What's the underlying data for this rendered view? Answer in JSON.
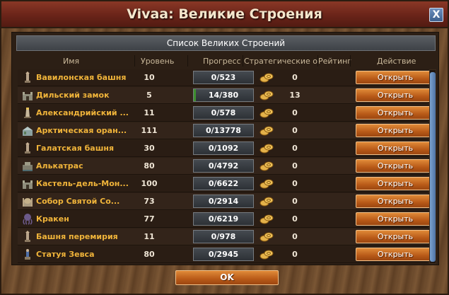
{
  "window": {
    "title": "Vivaa: Великие Строения",
    "close_label": "X",
    "subheader": "Список Великих Строений",
    "ok_label": "OK"
  },
  "columns": {
    "name": "Имя",
    "level": "Уровень",
    "progress": "Прогресс",
    "points": "Стратегические очки",
    "rating": "Рейтинг",
    "action": "Действие"
  },
  "colors": {
    "name_text": "#f0b43a",
    "button": "#c86a22",
    "progress_fill": "#3e8f2e",
    "title_bar": "#6a2419"
  },
  "buildings": [
    {
      "name": "Вавилонская башня",
      "level": "10",
      "progress": "0/523",
      "points": "0",
      "action": "Открыть",
      "icon": "tower-icon",
      "fill": 0
    },
    {
      "name": "Дильский замок",
      "level": "5",
      "progress": "14/380",
      "points": "13",
      "action": "Открыть",
      "icon": "castle-icon",
      "fill": 0.037
    },
    {
      "name": "Александрийский ...",
      "level": "11",
      "progress": "0/578",
      "points": "0",
      "action": "Открыть",
      "icon": "lighthouse-icon",
      "fill": 0
    },
    {
      "name": "Арктическая оран...",
      "level": "111",
      "progress": "0/13778",
      "points": "0",
      "action": "Открыть",
      "icon": "greenhouse-icon",
      "fill": 0
    },
    {
      "name": "Галатская башня",
      "level": "30",
      "progress": "0/1092",
      "points": "0",
      "action": "Открыть",
      "icon": "tower-icon",
      "fill": 0
    },
    {
      "name": "Алькатрас",
      "level": "80",
      "progress": "0/4792",
      "points": "0",
      "action": "Открыть",
      "icon": "prison-icon",
      "fill": 0
    },
    {
      "name": "Кастель-дель-Мон...",
      "level": "100",
      "progress": "0/6622",
      "points": "0",
      "action": "Открыть",
      "icon": "castle-icon",
      "fill": 0
    },
    {
      "name": "Собор Святой Со...",
      "level": "73",
      "progress": "0/2914",
      "points": "0",
      "action": "Открыть",
      "icon": "cathedral-icon",
      "fill": 0
    },
    {
      "name": "Кракен",
      "level": "77",
      "progress": "0/6219",
      "points": "0",
      "action": "Открыть",
      "icon": "kraken-icon",
      "fill": 0
    },
    {
      "name": "Башня перемирия",
      "level": "11",
      "progress": "0/978",
      "points": "0",
      "action": "Открыть",
      "icon": "tower-icon",
      "fill": 0
    },
    {
      "name": "Статуя Зевса",
      "level": "80",
      "progress": "0/2945",
      "points": "0",
      "action": "Открыть",
      "icon": "statue-icon",
      "fill": 0
    }
  ]
}
